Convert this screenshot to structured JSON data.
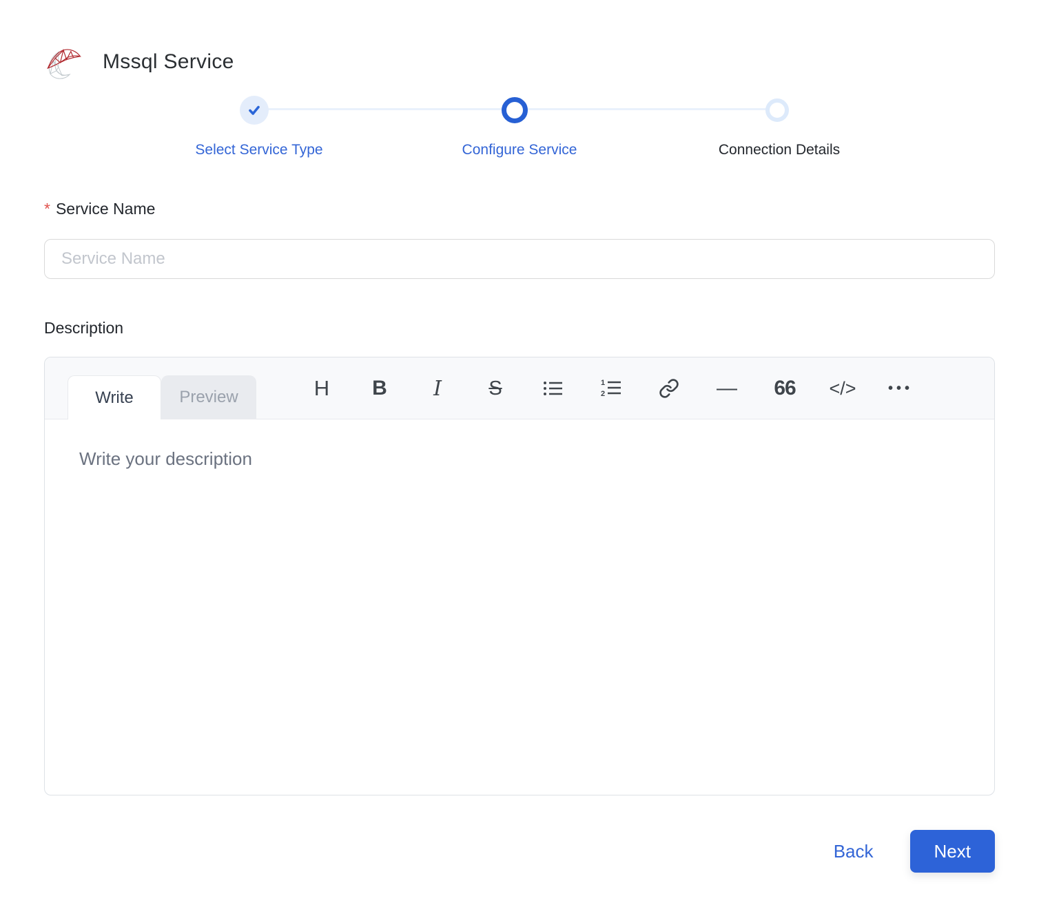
{
  "header": {
    "title": "Mssql Service",
    "logo": "sql-server-logo"
  },
  "stepper": {
    "steps": [
      {
        "label": "Select Service Type",
        "state": "completed"
      },
      {
        "label": "Configure Service",
        "state": "active"
      },
      {
        "label": "Connection Details",
        "state": "upcoming"
      }
    ]
  },
  "form": {
    "service_name": {
      "required_marker": "*",
      "label": "Service Name",
      "placeholder": "Service Name",
      "value": ""
    },
    "description": {
      "label": "Description",
      "tabs": [
        {
          "label": "Write",
          "active": true
        },
        {
          "label": "Preview",
          "active": false
        }
      ],
      "toolbar": [
        {
          "name": "heading-icon",
          "glyph": "H"
        },
        {
          "name": "bold-icon",
          "glyph": "B"
        },
        {
          "name": "italic-icon",
          "glyph": "I"
        },
        {
          "name": "strikethrough-icon",
          "glyph": "S"
        },
        {
          "name": "unordered-list-icon",
          "glyph": ""
        },
        {
          "name": "ordered-list-icon",
          "glyph": ""
        },
        {
          "name": "link-icon",
          "glyph": ""
        },
        {
          "name": "horizontal-rule-icon",
          "glyph": "—"
        },
        {
          "name": "quote-icon",
          "glyph": "66"
        },
        {
          "name": "code-icon",
          "glyph": "</>"
        },
        {
          "name": "more-icon",
          "glyph": "•••"
        }
      ],
      "placeholder": "Write your description",
      "value": ""
    }
  },
  "footer": {
    "back_label": "Back",
    "next_label": "Next"
  },
  "colors": {
    "accent_blue": "#2d63d8",
    "step_label_blue": "#3365d6",
    "step_done_bg": "#e4edfb",
    "step_upcoming_ring": "#ddeafb",
    "required_red": "#e0524d",
    "logo_red": "#b0262c",
    "logo_gray": "#c3cace"
  }
}
